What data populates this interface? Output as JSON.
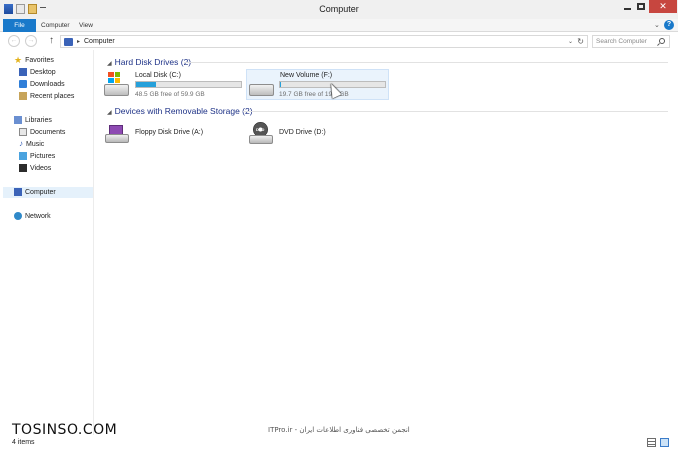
{
  "window": {
    "title": "Computer",
    "close_glyph": "✕"
  },
  "ribbon": {
    "tabs": [
      "File",
      "Computer",
      "View"
    ],
    "help_glyph": "?",
    "collapse_glyph": "⌄"
  },
  "address_bar": {
    "path": "Computer",
    "separator": "▸",
    "back_glyph": "←",
    "forward_glyph": "→",
    "up_glyph": "↑",
    "dropdown_glyph": "⌄",
    "refresh_glyph": "↻",
    "search_placeholder": "Search Computer"
  },
  "nav_pane": {
    "favorites": {
      "label": "Favorites",
      "icon": "star-icon"
    },
    "favorite_items": [
      {
        "label": "Desktop",
        "icon": "desktop-icon"
      },
      {
        "label": "Downloads",
        "icon": "downloads-icon"
      },
      {
        "label": "Recent places",
        "icon": "recent-places-icon"
      }
    ],
    "libraries": {
      "label": "Libraries",
      "icon": "libraries-icon"
    },
    "library_items": [
      {
        "label": "Documents",
        "icon": "documents-icon"
      },
      {
        "label": "Music",
        "icon": "music-icon"
      },
      {
        "label": "Pictures",
        "icon": "pictures-icon"
      },
      {
        "label": "Videos",
        "icon": "videos-icon"
      }
    ],
    "computer": {
      "label": "Computer",
      "icon": "computer-icon",
      "selected": true
    },
    "network": {
      "label": "Network",
      "icon": "network-icon"
    }
  },
  "content": {
    "hard_disk_group": {
      "title": "Hard Disk Drives (2)",
      "drives": [
        {
          "name": "Local Disk (C:)",
          "free_text": "48.5 GB free of 59.9 GB",
          "used_fraction": 0.19
        },
        {
          "name": "New Volume (F:)",
          "free_text": "19.7 GB free of 19.8 GB",
          "used_fraction": 0.005
        }
      ]
    },
    "removable_group": {
      "title": "Devices with Removable Storage (2)",
      "devices": [
        {
          "name": "Floppy Disk Drive (A:)",
          "icon": "floppy-drive-icon"
        },
        {
          "name": "DVD Drive (D:)",
          "icon": "dvd-drive-icon",
          "icon_text": "DVD"
        }
      ]
    },
    "group_chevron": "◢"
  },
  "status_bar": {
    "item_count": "4 items"
  },
  "watermarks": {
    "site": "TOSINSO.COM",
    "tagline": "ITPro.ir - انجمن تخصصی فناوری اطلاعات ایران"
  },
  "colors": {
    "accent": "#1979ca",
    "bar_fill": "#26a0da",
    "group_title": "#1e3287",
    "close": "#c7463f"
  }
}
